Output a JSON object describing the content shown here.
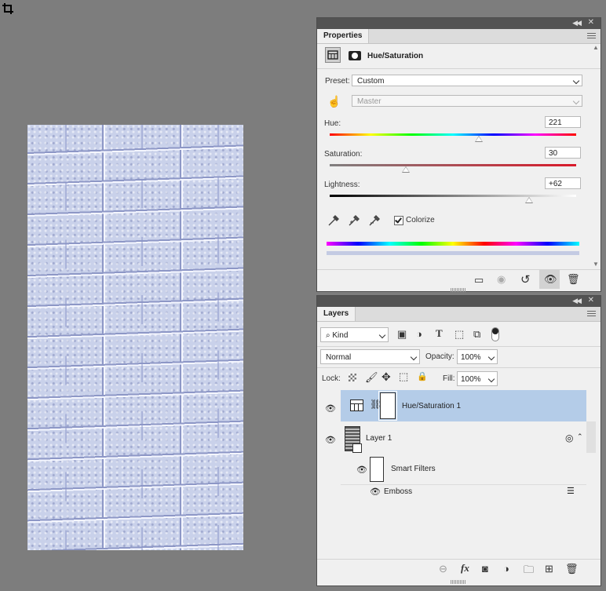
{
  "properties": {
    "tab_label": "Properties",
    "adjustment_title": "Hue/Saturation",
    "preset_label": "Preset:",
    "preset_value": "Custom",
    "channel_value": "Master",
    "hue_label": "Hue:",
    "hue_value": "221",
    "hue_position": 0.605,
    "saturation_label": "Saturation:",
    "saturation_value": "30",
    "saturation_position": 0.31,
    "lightness_label": "Lightness:",
    "lightness_value": "+62",
    "lightness_position": 0.81,
    "colorize_label": "Colorize",
    "colorize_checked": true
  },
  "layers": {
    "tab_label": "Layers",
    "filter_kind": "Kind",
    "blend_mode": "Normal",
    "opacity_label": "Opacity:",
    "opacity_value": "100%",
    "lock_label": "Lock:",
    "fill_label": "Fill:",
    "fill_value": "100%",
    "items": [
      {
        "name": "Hue/Saturation 1",
        "selected": true
      },
      {
        "name": "Layer 1",
        "selected": false
      },
      {
        "name": "Smart Filters",
        "selected": false
      },
      {
        "name": "Emboss",
        "selected": false
      }
    ]
  },
  "colors": {
    "selection": "#b4cce8",
    "panel_bg": "#f0f0f0",
    "workspace": "#7d7d7d",
    "canvas_tint": "#c9d1ea"
  }
}
